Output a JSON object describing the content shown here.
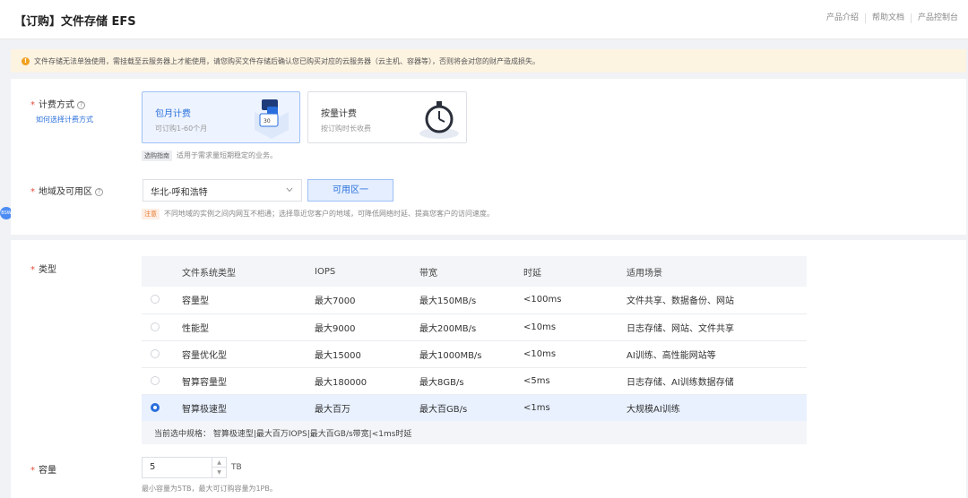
{
  "header": {
    "title": "【订购】文件存储 EFS",
    "links": [
      "产品介绍",
      "帮助文档",
      "产品控制台"
    ]
  },
  "notice": {
    "text": "文件存储无法单独使用，需挂载至云服务器上才能使用，请您购买文件存储后确认您已购买对应的云服务器（云主机、容器等），否则将会对您的财产造成损失。"
  },
  "billing": {
    "label": "计费方式",
    "help_link": "如何选择计费方式",
    "options": [
      {
        "title": "包月计费",
        "desc": "可订购1-60个月",
        "selected": true
      },
      {
        "title": "按量计费",
        "desc": "按订购时长收费",
        "selected": false
      }
    ],
    "guide_tag": "选购指南",
    "guide_text": "适用于需求量短期稳定的业务。"
  },
  "region": {
    "label": "地域及可用区",
    "selected": "华北-呼和浩特",
    "zone": "可用区一",
    "note_tag": "注意",
    "note_text": "不同地域的实例之间内网互不相通；选择靠近您客户的地域，可降低网络时延、提高您客户的访问速度。"
  },
  "side_bubble": "BSW",
  "type": {
    "label": "类型",
    "columns": [
      "文件系统类型",
      "IOPS",
      "带宽",
      "时延",
      "适用场景"
    ],
    "rows": [
      {
        "name": "容量型",
        "iops": "最大7000",
        "bandwidth": "最大150MB/s",
        "latency": "<100ms",
        "scenario": "文件共享、数据备份、网站",
        "selected": false
      },
      {
        "name": "性能型",
        "iops": "最大9000",
        "bandwidth": "最大200MB/s",
        "latency": "<10ms",
        "scenario": "日志存储、网站、文件共享",
        "selected": false
      },
      {
        "name": "容量优化型",
        "iops": "最大15000",
        "bandwidth": "最大1000MB/s",
        "latency": "<10ms",
        "scenario": "AI训练、高性能网站等",
        "selected": false
      },
      {
        "name": "智算容量型",
        "iops": "最大180000",
        "bandwidth": "最大8GB/s",
        "latency": "<5ms",
        "scenario": "日志存储、AI训练数据存储",
        "selected": false
      },
      {
        "name": "智算极速型",
        "iops": "最大百万",
        "bandwidth": "最大百GB/s",
        "latency": "<1ms",
        "scenario": "大规模AI训练",
        "selected": true
      }
    ],
    "summary": "当前选中规格： 智算极速型|最大百万IOPS|最大百GB/s带宽|<1ms时延"
  },
  "capacity": {
    "label": "容量",
    "value": "5",
    "unit": "TB",
    "hint": "最小容量为5TB，最大可订购容量为1PB。"
  },
  "colors": {
    "accent": "#2a6fdb",
    "required": "#e34d3b",
    "notice_bg": "#fdf3e1",
    "warning": "#f0a020",
    "selected_row": "#e9f1ff"
  }
}
